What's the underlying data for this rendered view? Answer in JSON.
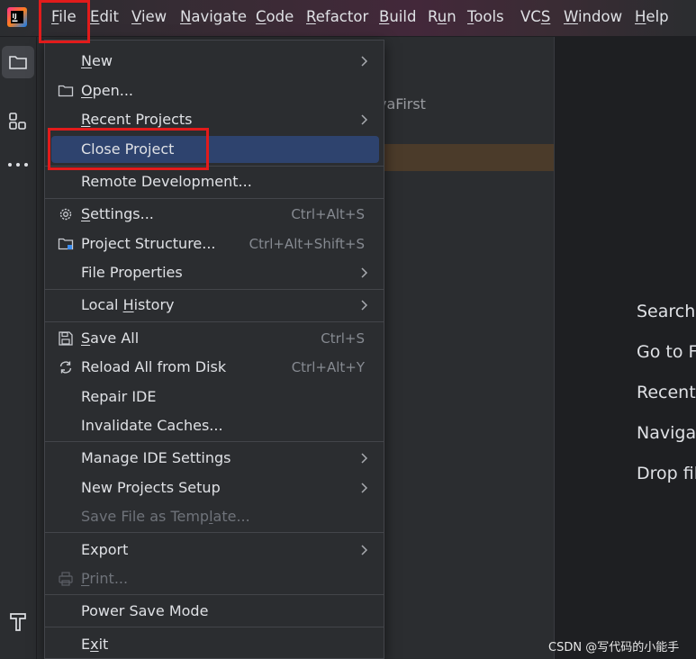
{
  "menubar": {
    "items": [
      {
        "pre": "",
        "u": "F",
        "post": "ile"
      },
      {
        "pre": "",
        "u": "E",
        "post": "dit"
      },
      {
        "pre": "",
        "u": "V",
        "post": "iew"
      },
      {
        "pre": "",
        "u": "N",
        "post": "avigate"
      },
      {
        "pre": "",
        "u": "C",
        "post": "ode"
      },
      {
        "pre": "",
        "u": "R",
        "post": "efactor"
      },
      {
        "pre": "",
        "u": "B",
        "post": "uild"
      },
      {
        "pre": "R",
        "u": "u",
        "post": "n"
      },
      {
        "pre": "",
        "u": "T",
        "post": "ools"
      },
      {
        "pre": "VC",
        "u": "S",
        "post": ""
      },
      {
        "pre": "",
        "u": "W",
        "post": "indow"
      },
      {
        "pre": "",
        "u": "H",
        "post": "elp"
      }
    ]
  },
  "background": {
    "project_text": "vaFirst",
    "welcome": [
      "Search",
      "Go to F",
      "Recent",
      "Naviga",
      "Drop fil"
    ],
    "watermark": "CSDN @写代码的小能手"
  },
  "file_menu": {
    "items": [
      {
        "pre": "",
        "u": "N",
        "post": "ew",
        "shortcut": "",
        "arrow": true,
        "icon": ""
      },
      {
        "pre": "",
        "u": "O",
        "post": "pen...",
        "shortcut": "",
        "arrow": false,
        "icon": "folder-icon"
      },
      {
        "pre": "",
        "u": "R",
        "post": "ecent Projects",
        "shortcut": "",
        "arrow": true,
        "icon": ""
      },
      {
        "pre": "Close Project",
        "u": "",
        "post": "",
        "shortcut": "",
        "arrow": false,
        "icon": ""
      },
      {
        "pre": "Remote Development...",
        "u": "",
        "post": "",
        "shortcut": "",
        "arrow": false,
        "icon": ""
      },
      {
        "pre": "",
        "u": "S",
        "post": "ettings...",
        "shortcut": "Ctrl+Alt+S",
        "arrow": false,
        "icon": "gear-icon"
      },
      {
        "pre": "Project Structure...",
        "u": "",
        "post": "",
        "shortcut": "Ctrl+Alt+Shift+S",
        "arrow": false,
        "icon": "project-structure-icon"
      },
      {
        "pre": "File Properties",
        "u": "",
        "post": "",
        "shortcut": "",
        "arrow": true,
        "icon": ""
      },
      {
        "pre": "Local ",
        "u": "H",
        "post": "istory",
        "shortcut": "",
        "arrow": true,
        "icon": ""
      },
      {
        "pre": "",
        "u": "S",
        "post": "ave All",
        "shortcut": "Ctrl+S",
        "arrow": false,
        "icon": "save-icon"
      },
      {
        "pre": "Reload All from Disk",
        "u": "",
        "post": "",
        "shortcut": "Ctrl+Alt+Y",
        "arrow": false,
        "icon": "reload-icon"
      },
      {
        "pre": "Repair IDE",
        "u": "",
        "post": "",
        "shortcut": "",
        "arrow": false,
        "icon": ""
      },
      {
        "pre": "Invalidate Caches...",
        "u": "",
        "post": "",
        "shortcut": "",
        "arrow": false,
        "icon": ""
      },
      {
        "pre": "Manage IDE Settings",
        "u": "",
        "post": "",
        "shortcut": "",
        "arrow": true,
        "icon": ""
      },
      {
        "pre": "New Projects Setup",
        "u": "",
        "post": "",
        "shortcut": "",
        "arrow": true,
        "icon": ""
      },
      {
        "pre": "Save File as Temp",
        "u": "l",
        "post": "ate...",
        "shortcut": "",
        "arrow": false,
        "icon": ""
      },
      {
        "pre": "Export",
        "u": "",
        "post": "",
        "shortcut": "",
        "arrow": true,
        "icon": ""
      },
      {
        "pre": "",
        "u": "P",
        "post": "rint...",
        "shortcut": "",
        "arrow": false,
        "icon": "print-icon"
      },
      {
        "pre": "Power Save Mode",
        "u": "",
        "post": "",
        "shortcut": "",
        "arrow": false,
        "icon": ""
      },
      {
        "pre": "E",
        "u": "x",
        "post": "it",
        "shortcut": "",
        "arrow": false,
        "icon": ""
      }
    ],
    "highlighted": "Close Project",
    "disabled": [
      "Save File as Template...",
      "Print..."
    ]
  },
  "colors": {
    "highlight": "#2e436e",
    "annotation_red": "#e21b1b"
  }
}
